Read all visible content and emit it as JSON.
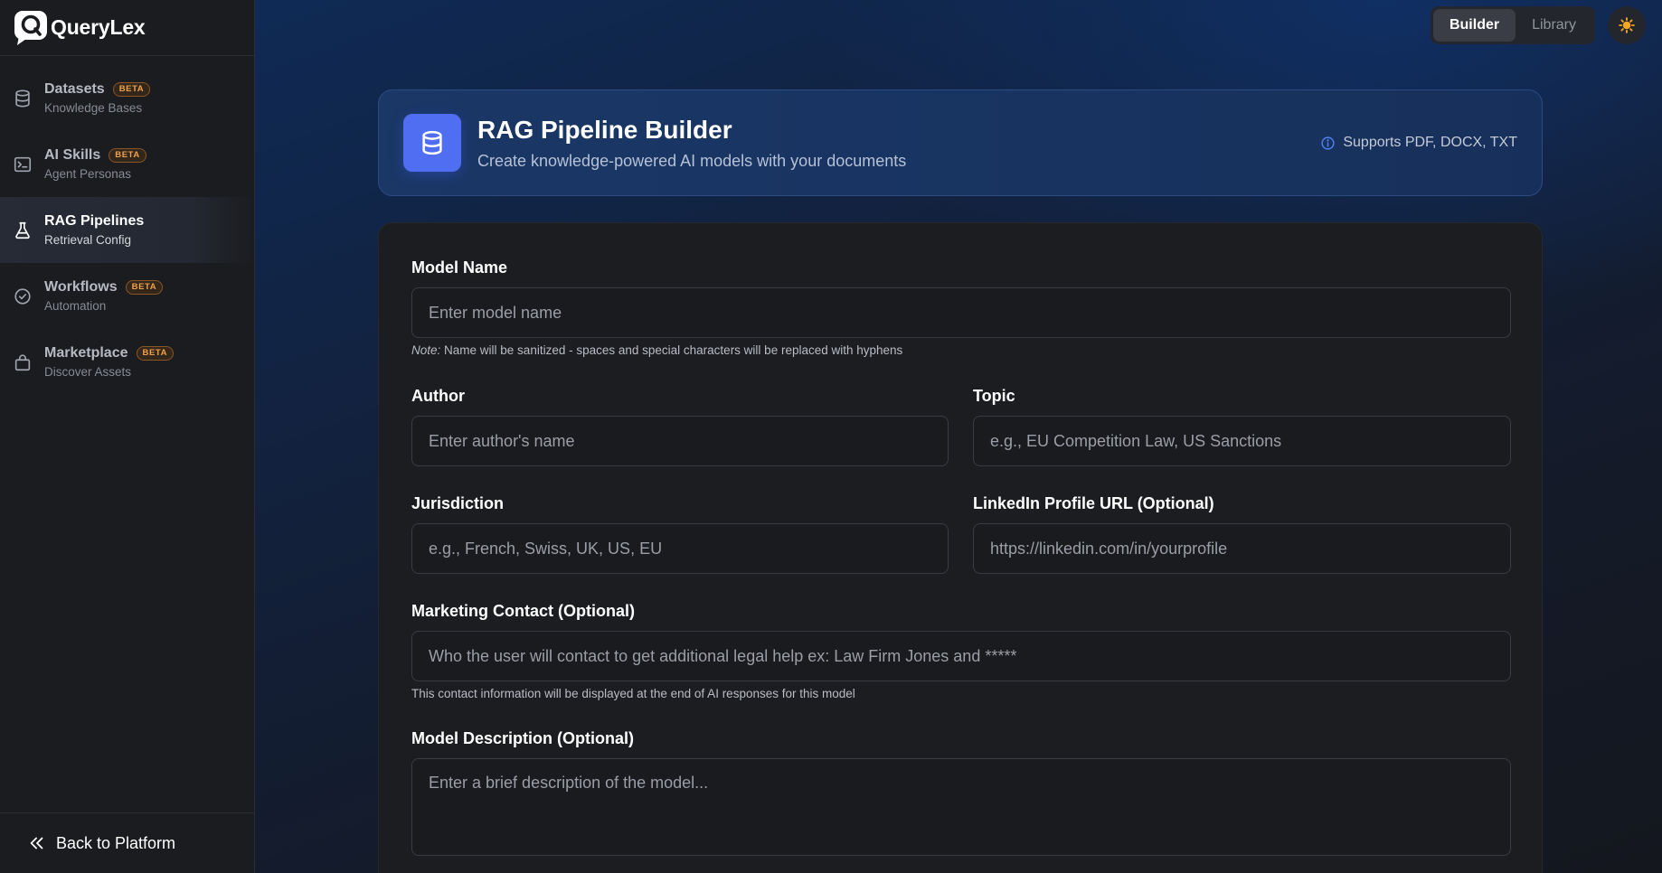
{
  "app": {
    "name": "QueryLex"
  },
  "sidebar": {
    "items": [
      {
        "title": "Datasets",
        "subtitle": "Knowledge Bases",
        "badge": "BETA",
        "icon": "database-icon"
      },
      {
        "title": "AI Skills",
        "subtitle": "Agent Personas",
        "badge": "BETA",
        "icon": "terminal-icon"
      },
      {
        "title": "RAG Pipelines",
        "subtitle": "Retrieval Config",
        "badge": "",
        "icon": "flask-icon",
        "active": true
      },
      {
        "title": "Workflows",
        "subtitle": "Automation",
        "badge": "BETA",
        "icon": "check-circle-icon"
      },
      {
        "title": "Marketplace",
        "subtitle": "Discover Assets",
        "badge": "BETA",
        "icon": "shopping-bag-icon"
      }
    ],
    "back_label": "Back to Platform"
  },
  "topbar": {
    "tabs": [
      "Builder",
      "Library"
    ],
    "active_tab": "Builder",
    "theme_icon": "sun-icon"
  },
  "header": {
    "title": "RAG Pipeline Builder",
    "subtitle": "Create knowledge-powered AI models with your documents",
    "supports": "Supports PDF, DOCX, TXT"
  },
  "form": {
    "model_name": {
      "label": "Model Name",
      "placeholder": "Enter model name",
      "value": ""
    },
    "model_name_note": {
      "prefix": "Note:",
      "text": " Name will be sanitized - spaces and special characters will be replaced with hyphens"
    },
    "author": {
      "label": "Author",
      "placeholder": "Enter author's name",
      "value": ""
    },
    "topic": {
      "label": "Topic",
      "placeholder": "e.g., EU Competition Law, US Sanctions",
      "value": ""
    },
    "jurisdiction": {
      "label": "Jurisdiction",
      "placeholder": "e.g., French, Swiss, UK, US, EU",
      "value": ""
    },
    "linkedin": {
      "label": "LinkedIn Profile URL (Optional)",
      "placeholder": "https://linkedin.com/in/yourprofile",
      "value": ""
    },
    "marketing": {
      "label": "Marketing Contact (Optional)",
      "placeholder": "Who the user will contact to get additional legal help ex: Law Firm Jones and *****",
      "value": ""
    },
    "marketing_hint": "This contact information will be displayed at the end of AI responses for this model",
    "description": {
      "label": "Model Description (Optional)",
      "placeholder": "Enter a brief description of the model...",
      "value": ""
    }
  },
  "colors": {
    "accent": "#4f6ef2",
    "badge": "#f0a24a",
    "sun": "#f5a623"
  }
}
